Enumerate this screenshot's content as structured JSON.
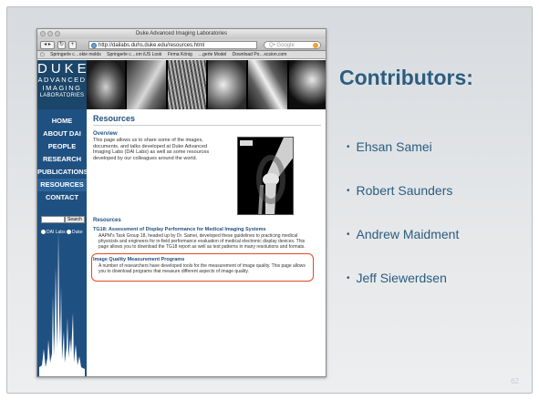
{
  "slide": {
    "title": "Contributors:",
    "contributors": [
      "Ehsan Samei",
      "Robert Saunders",
      "Andrew Maidment",
      "Jeff Siewerdsen"
    ],
    "page_number": "62"
  },
  "browser": {
    "window_title": "Duke Advanced Imaging Laboratories",
    "url": "http://dailabs.duhs.duke.edu/resources.html",
    "search_placeholder": "Q• Google",
    "bookmarks": [
      "Springerle c…okie molds",
      "Springerle c…om iUS Look",
      "Firma König",
      "…gerle Model",
      "Download Po…xcsion.com"
    ]
  },
  "site": {
    "logo": {
      "line1": "DUKE",
      "line2": "ADVANCED",
      "line3": "IMAGING",
      "line4": "LABORATORIES"
    },
    "nav": [
      "HOME",
      "ABOUT DAI",
      "PEOPLE",
      "RESEARCH",
      "PUBLICATIONS",
      "RESOURCES",
      "CONTACT"
    ],
    "active_nav": "RESOURCES",
    "search_button": "Search",
    "radio_1": "DAI Labs",
    "radio_2": "Duke",
    "page_title": "Resources",
    "overview_heading": "Overview",
    "overview_text": "This page allows us to share some of the images, documents, and talks developed at Duke Advanced Imaging Labs (DAI Labs) as well as some resources developed by our colleagues around the world.",
    "resources_heading": "Resources",
    "items": [
      {
        "title": "TG18: Assessment of Display Performance for Medical Imaging Systems",
        "text": "AAPM's Task Group 18, headed up by Dr. Samei, developed these guidelines to practicing medical physicists and engineers for in-field performance evaluation of medical electronic display devices. This page allows you to download the TG18 report as well as test patterns in many resolutions and formats."
      },
      {
        "title": "Image Quality Measurement Programs",
        "text": "A number of researchers have developed tools for the measurement of image quality. This page allows you to download programs that measure different aspects of image quality."
      }
    ]
  },
  "colors": {
    "accent": "#2b5d80",
    "nav_bg": "#1f5082",
    "highlight": "#e24a24"
  }
}
